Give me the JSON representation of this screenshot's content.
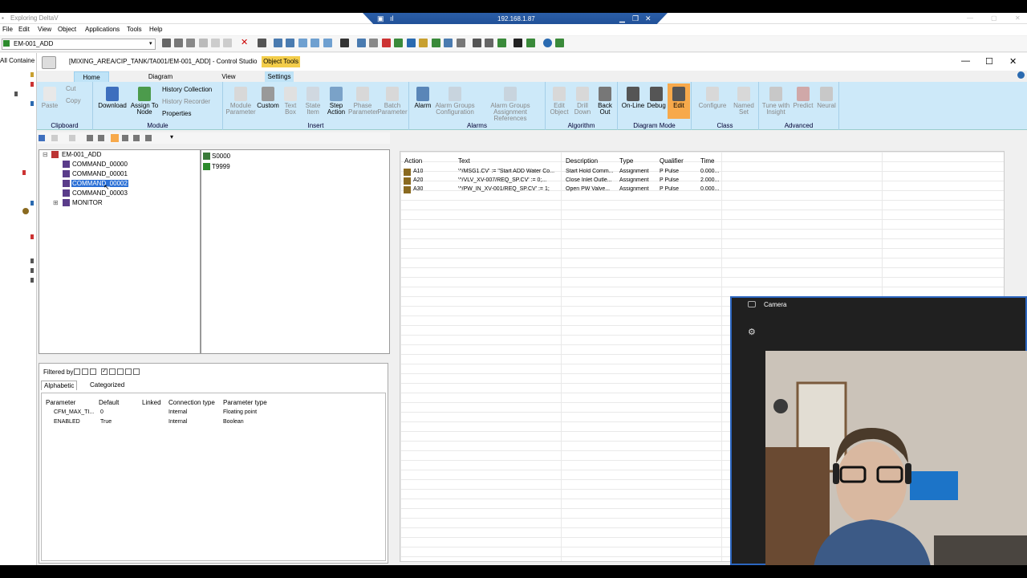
{
  "outer": {
    "title": "Exploring DeltaV",
    "remote_ip": "192.168.1.87",
    "menu": [
      "File",
      "Edit",
      "View",
      "Object",
      "Applications",
      "Tools",
      "Help"
    ],
    "object_combo": "EM-001_ADD",
    "left_label": "All Containe"
  },
  "window": {
    "title": "[MIXING_AREA/CIP_TANK/TA001/EM-001_ADD] - Control Studio",
    "object_tools": "Object Tools",
    "tabs": [
      "Home",
      "Diagram",
      "View",
      "Settings"
    ],
    "active_tab": "Home"
  },
  "ribbon": {
    "clipboard": {
      "name": "Clipboard",
      "paste": "Paste",
      "cut": "Cut",
      "copy": "Copy"
    },
    "module": {
      "name": "Module",
      "download": "Download",
      "assign_to_node": "Assign To Node",
      "history_collection": "History Collection",
      "history_recorder": "History Recorder",
      "properties": "Properties"
    },
    "insert": {
      "name": "Insert",
      "items": [
        "Module Parameter",
        "Custom",
        "Text Box",
        "State Item",
        "Step Action",
        "Phase Parameter",
        "Batch Parameter"
      ]
    },
    "alarms": {
      "name": "Alarms",
      "items": [
        "Alarm",
        "Alarm Groups Configuration",
        "Alarm Groups Assignment References"
      ]
    },
    "algorithm": {
      "name": "Algorithm",
      "items": [
        "Edit Object",
        "Drill Down",
        "Back Out"
      ]
    },
    "diagram_mode": {
      "name": "Diagram Mode",
      "items": [
        "On-Line",
        "Debug",
        "Edit"
      ],
      "selected": "Edit"
    },
    "class": {
      "name": "Class",
      "items": [
        "Configure",
        "Named Set"
      ]
    },
    "advanced": {
      "name": "Advanced",
      "items": [
        "Tune with Insight",
        "Predict",
        "Neural"
      ]
    }
  },
  "tree": {
    "root": "EM-001_ADD",
    "items": [
      "COMMAND_00000",
      "COMMAND_00001",
      "COMMAND_00002",
      "COMMAND_00003",
      "MONITOR"
    ],
    "selected": "COMMAND_00002"
  },
  "steps": [
    "S0000",
    "T9999"
  ],
  "actions": {
    "headers": [
      "Action",
      "Text",
      "Description",
      "Type",
      "Qualifier",
      "Time"
    ],
    "rows": [
      {
        "action": "A10",
        "text": "'^/MSG1.CV' := \"Start ADD Water Co...",
        "description": "Start Hold Comm...",
        "type": "Assignment",
        "qualifier": "P Pulse",
        "time": "0.000..."
      },
      {
        "action": "A20",
        "text": "'^/VLV_XV-007/REQ_SP.CV' := 0;...",
        "description": "Close Inlet Outle...",
        "type": "Assignment",
        "qualifier": "P Pulse",
        "time": "2.000..."
      },
      {
        "action": "A30",
        "text": "'^/PW_IN_XV-001/REQ_SP.CV' := 1;",
        "description": "Open PW Valve...",
        "type": "Assignment",
        "qualifier": "P Pulse",
        "time": "0.000..."
      }
    ]
  },
  "params": {
    "filtered_by": "Filtered by:",
    "tabs": [
      "Alphabetic",
      "Categorized"
    ],
    "headers": [
      "Parameter",
      "Default",
      "Linked",
      "Connection type",
      "Parameter type"
    ],
    "rows": [
      {
        "parameter": "CFM_MAX_TI...",
        "default": "0",
        "linked": "",
        "connection": "Internal",
        "ptype": "Floating point"
      },
      {
        "parameter": "ENABLED",
        "default": "True",
        "linked": "",
        "connection": "Internal",
        "ptype": "Boolean"
      }
    ]
  },
  "camera": {
    "title": "Camera"
  },
  "colors": {
    "ribbon": "#cde9f9",
    "selection": "#2b70d6",
    "edit_highlight": "#f7a94b",
    "object_tools": "#f3cd4a"
  }
}
